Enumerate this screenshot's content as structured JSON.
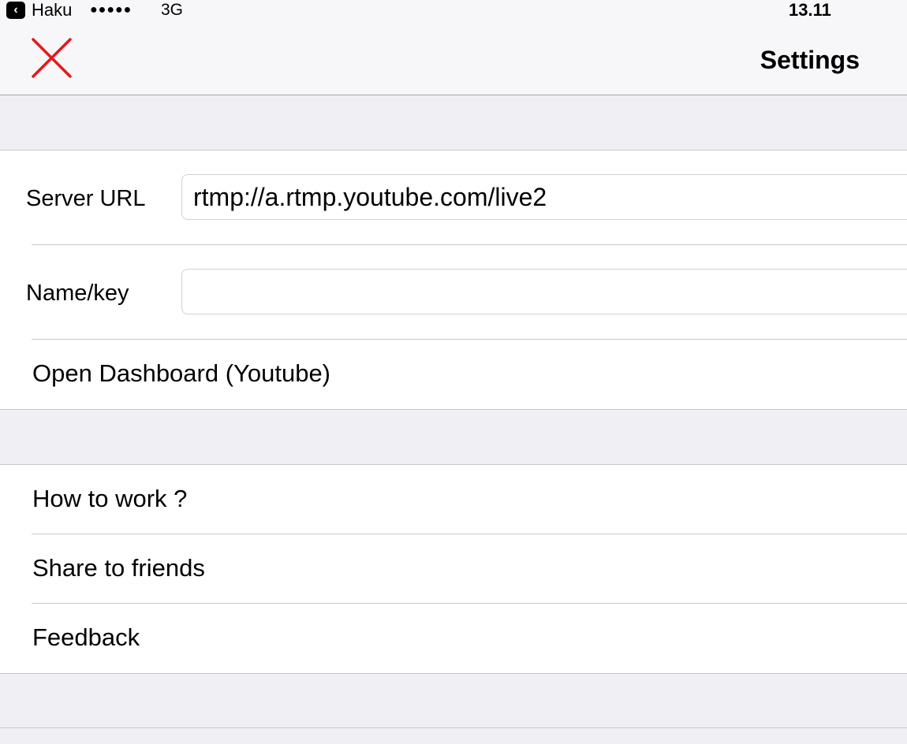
{
  "status_bar": {
    "back_app": "Haku",
    "signal": "●●●●●",
    "network": "3G",
    "time": "13.11"
  },
  "nav": {
    "title": "Settings",
    "close_icon_color": "#e3191b"
  },
  "stream": {
    "server_url_label": "Server URL",
    "server_url_value": "rtmp://a.rtmp.youtube.com/live2",
    "name_key_label": "Name/key",
    "name_key_value": "",
    "dashboard_label": "Open Dashboard (Youtube)"
  },
  "more": {
    "items": [
      {
        "label": "How to work ?"
      },
      {
        "label": "Share to friends"
      },
      {
        "label": "Feedback"
      }
    ]
  },
  "colors": {
    "background": "#efeff4",
    "cell": "#ffffff",
    "separator": "#c8c7cc",
    "close": "#e3191b"
  }
}
